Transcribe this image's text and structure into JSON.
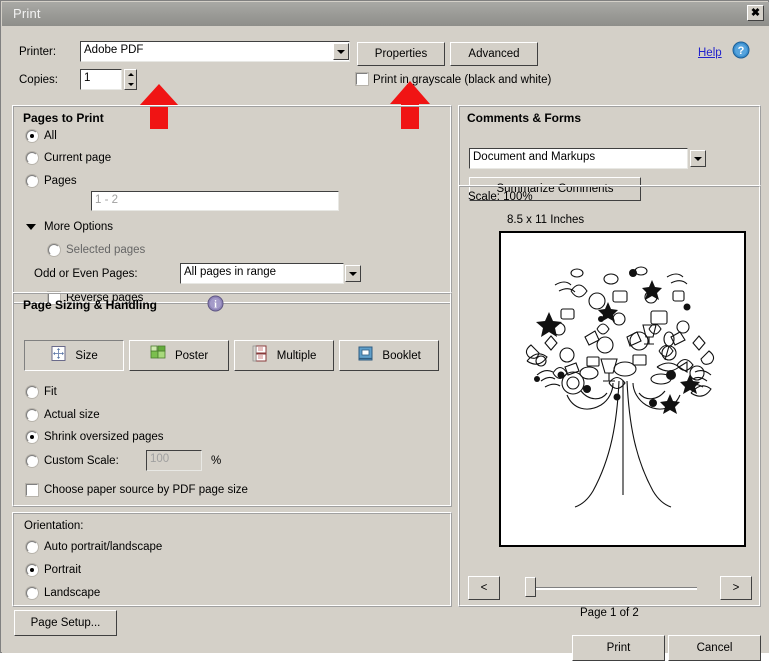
{
  "window": {
    "title": "Print",
    "close_label": "✖"
  },
  "printer": {
    "label": "Printer:",
    "value": "Adobe PDF",
    "properties_button": "Properties",
    "advanced_button": "Advanced",
    "copies_label": "Copies:",
    "copies_value": "1",
    "grayscale_label": "Print in grayscale (black and white)",
    "grayscale_checked": false
  },
  "help": {
    "label": "Help",
    "icon": "question-circle-icon"
  },
  "pages_to_print": {
    "title": "Pages to Print",
    "options": [
      {
        "label": "All",
        "selected": true
      },
      {
        "label": "Current page",
        "selected": false
      },
      {
        "label": "Pages",
        "selected": false
      }
    ],
    "pages_placeholder": "1 - 2",
    "more_options_label": "More Options",
    "more_options_expanded": true,
    "selected_pages_label": "Selected pages",
    "selected_pages_selected": false,
    "odd_even_label": "Odd or Even Pages:",
    "odd_even_value": "All pages in range",
    "reverse_pages_label": "Reverse pages",
    "reverse_pages_checked": false
  },
  "page_sizing": {
    "title": "Page Sizing & Handling",
    "info_icon": "info-circle-icon",
    "tabs": [
      {
        "label": "Size",
        "icon": "size-icon",
        "active": true
      },
      {
        "label": "Poster",
        "icon": "poster-icon",
        "active": false
      },
      {
        "label": "Multiple",
        "icon": "multiple-icon",
        "active": false
      },
      {
        "label": "Booklet",
        "icon": "booklet-icon",
        "active": false
      }
    ],
    "options": [
      {
        "label": "Fit",
        "selected": false
      },
      {
        "label": "Actual size",
        "selected": false
      },
      {
        "label": "Shrink oversized pages",
        "selected": true
      },
      {
        "label": "Custom Scale:",
        "selected": false
      }
    ],
    "custom_scale_value": "100",
    "percent_label": "%",
    "paper_source_label": "Choose paper source by PDF page size",
    "paper_source_checked": false
  },
  "orientation": {
    "title": "Orientation:",
    "options": [
      {
        "label": "Auto portrait/landscape",
        "selected": false
      },
      {
        "label": "Portrait",
        "selected": true
      },
      {
        "label": "Landscape",
        "selected": false
      }
    ]
  },
  "comments_forms": {
    "title": "Comments & Forms",
    "value": "Document and Markups",
    "summarize_button": "Summarize Comments"
  },
  "preview": {
    "scale_label": "Scale: 100%",
    "size_label": "8.5 x 11 Inches",
    "page_indicator": "Page 1 of 2",
    "prev_button": "<",
    "next_button": ">",
    "slider_position_percent": 0
  },
  "footer": {
    "page_setup_button": "Page Setup...",
    "print_button": "Print",
    "cancel_button": "Cancel"
  },
  "annotations": {
    "arrow_color": "#f01414",
    "arrows": [
      {
        "name": "arrow-printer-dropdown",
        "points_to": "printer-dropdown"
      },
      {
        "name": "arrow-properties-button",
        "points_to": "properties-button"
      }
    ]
  },
  "colors": {
    "dialog_bg": "#d4d0c8",
    "titlebar": "#9b9b97",
    "link": "#2222cc",
    "arrow_red": "#f01414"
  }
}
